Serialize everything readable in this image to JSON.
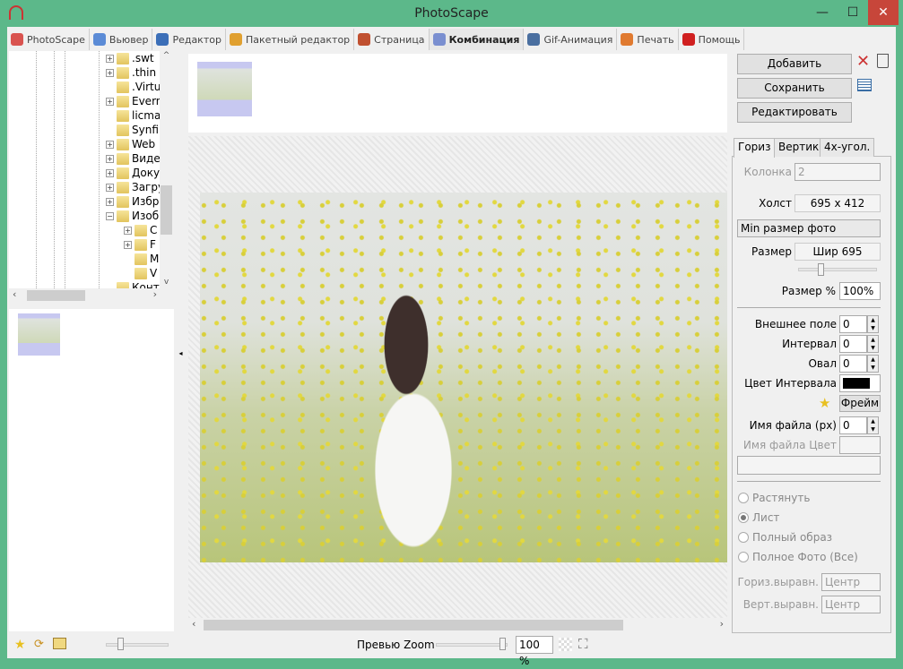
{
  "window": {
    "title": "PhotoScape",
    "minimize": "—",
    "maximize": "☐",
    "close": "✕",
    "close_color": "#c7463a"
  },
  "tabs": [
    {
      "label": "PhotoScape",
      "color": "#d9534f"
    },
    {
      "label": "Вьювер",
      "color": "#5b8bd6"
    },
    {
      "label": "Редактор",
      "color": "#3c6fb8"
    },
    {
      "label": "Пакетный редактор",
      "color": "#e0a030"
    },
    {
      "label": "Страница",
      "color": "#c05030"
    },
    {
      "label": "Комбинация",
      "color": "#7a8fd0",
      "active": true
    },
    {
      "label": "Gif-Анимация",
      "color": "#4a6fa0"
    },
    {
      "label": "Печать",
      "color": "#e07a30"
    },
    {
      "label": "Помощь",
      "color": "#d02020"
    }
  ],
  "tree": [
    {
      "label": ".swt",
      "pm": "+"
    },
    {
      "label": ".thin",
      "pm": "+"
    },
    {
      "label": ".Virtu",
      "pm": ""
    },
    {
      "label": "Evern",
      "pm": "+"
    },
    {
      "label": "licma",
      "pm": ""
    },
    {
      "label": "Synfi",
      "pm": ""
    },
    {
      "label": "Web",
      "pm": "+"
    },
    {
      "label": "Виде",
      "pm": "+"
    },
    {
      "label": "Доку",
      "pm": "+"
    },
    {
      "label": "Загру",
      "pm": "+"
    },
    {
      "label": "Избр",
      "pm": "+"
    },
    {
      "label": "Изоб",
      "pm": "−"
    },
    {
      "label": "C",
      "pm": "+",
      "sub": true
    },
    {
      "label": "F",
      "pm": "+",
      "sub": true
    },
    {
      "label": "M",
      "pm": "",
      "sub": true
    },
    {
      "label": "V",
      "pm": "",
      "sub": true
    },
    {
      "label": "Конт",
      "pm": ""
    }
  ],
  "buttons": {
    "add": "Добавить",
    "save": "Сохранить",
    "edit": "Редактировать"
  },
  "right_tabs": [
    "Гориз",
    "Вертик",
    "4х-угол."
  ],
  "settings": {
    "column_label": "Колонка",
    "column_value": "2",
    "canvas_label": "Холст",
    "canvas_value": "695 x 412",
    "size_mode": "Min размер фото",
    "size_label": "Размер",
    "size_value": "Шир 695",
    "size_pct_label": "Размер %",
    "size_pct_value": "100%",
    "margin_label": "Внешнее поле",
    "margin_value": "0",
    "interval_label": "Интервал",
    "interval_value": "0",
    "oval_label": "Овал",
    "oval_value": "0",
    "interval_color_label": "Цвет Интервала",
    "interval_color": "#000000",
    "frame_button": "Фрейм",
    "filename_label": "Имя файла (px)",
    "filename_value": "0",
    "filename_color_label": "Имя файла Цвет"
  },
  "radios": [
    {
      "label": "Растянуть",
      "checked": false
    },
    {
      "label": "Лист",
      "checked": true
    },
    {
      "label": "Полный образ",
      "checked": false
    },
    {
      "label": "Полное Фото (Все)",
      "checked": false
    }
  ],
  "align": {
    "h_label": "Гориз.выравн.",
    "h_value": "Центр",
    "v_label": "Верт.выравн.",
    "v_value": "Центр"
  },
  "bottom": {
    "preview_zoom_label": "Превью Zoom",
    "zoom_value": "100 %"
  }
}
